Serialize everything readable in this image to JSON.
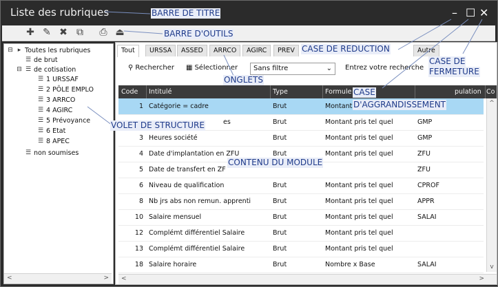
{
  "window": {
    "title": "Liste des rubriques",
    "controls": {
      "minimize": "–",
      "maximize": "☐",
      "close": "✕"
    }
  },
  "toolbar": {
    "icons": [
      {
        "name": "add-icon",
        "glyph": "✚"
      },
      {
        "name": "edit-icon",
        "glyph": "✎"
      },
      {
        "name": "delete-icon",
        "glyph": "✖"
      },
      {
        "name": "duplicate-icon",
        "glyph": "⧉"
      },
      {
        "name": "print-icon",
        "glyph": "⎙"
      },
      {
        "name": "export-icon",
        "glyph": "⏏"
      }
    ]
  },
  "tree": {
    "items": [
      {
        "label": "Toutes les rubriques",
        "expander": "⊟",
        "glyph": "▸",
        "level": 0
      },
      {
        "label": "de brut",
        "expander": "",
        "glyph": "☰",
        "level": 1
      },
      {
        "label": "de cotisation",
        "expander": "⊟",
        "glyph": "☰",
        "level": 1
      },
      {
        "label": "1 URSSAF",
        "expander": "",
        "glyph": "☰",
        "level": 2
      },
      {
        "label": "2 PÔLE EMPLO",
        "expander": "",
        "glyph": "☰",
        "level": 2
      },
      {
        "label": "3 ARRCO",
        "expander": "",
        "glyph": "☰",
        "level": 2
      },
      {
        "label": "4 AGIRC",
        "expander": "",
        "glyph": "☰",
        "level": 2
      },
      {
        "label": "5 Prévoyance",
        "expander": "",
        "glyph": "☰",
        "level": 2
      },
      {
        "label": "6 Etat",
        "expander": "",
        "glyph": "☰",
        "level": 2
      },
      {
        "label": "8 APEC",
        "expander": "",
        "glyph": "☰",
        "level": 2
      },
      {
        "label": "non soumises",
        "expander": "",
        "glyph": "☰",
        "level": 1
      }
    ],
    "scroll_left": "<",
    "scroll_right": ">"
  },
  "tabs": [
    "Tout",
    "URSSA",
    "ASSED",
    "ARRCO",
    "AGIRC",
    "PREV",
    "Autre"
  ],
  "search": {
    "search_label": "Rechercher",
    "select_label": "Sélectionner",
    "filter_value": "Sans filtre",
    "prompt": "Entrez votre recherche"
  },
  "table": {
    "columns": [
      "Code",
      "Intitulé",
      "Type",
      "Formule",
      "pulation",
      "Co"
    ],
    "rows": [
      {
        "code": "1",
        "label": "Catégorie = cadre",
        "type": "Brut",
        "formula": "Montant",
        "pop": ""
      },
      {
        "code": "",
        "label": "es",
        "type": "Brut",
        "formula": "Montant pris tel quel",
        "pop": "GMP"
      },
      {
        "code": "3",
        "label": "Heures société",
        "type": "Brut",
        "formula": "Montant pris tel quel",
        "pop": "GMP"
      },
      {
        "code": "4",
        "label": "Date d'implantation en ZFU",
        "type": "Brut",
        "formula": "Montant pris tel quel",
        "pop": "ZFU"
      },
      {
        "code": "5",
        "label": "Date de transfert en ZF",
        "type": "",
        "formula": "",
        "pop": "ZFU"
      },
      {
        "code": "6",
        "label": "Niveau de qualification",
        "type": "Brut",
        "formula": "Montant pris tel quel",
        "pop": "CPROF"
      },
      {
        "code": "8",
        "label": "Nb jrs abs non remun. apprenti",
        "type": "Brut",
        "formula": "Montant pris tel quel",
        "pop": "APPR"
      },
      {
        "code": "10",
        "label": "Salaire mensuel",
        "type": "Brut",
        "formula": "Montant pris tel quel",
        "pop": "SALAI"
      },
      {
        "code": "12",
        "label": "Complémt différentiel Salaire",
        "type": "Brut",
        "formula": "Montant pris tel quel",
        "pop": ""
      },
      {
        "code": "13",
        "label": "Complémt différentiel Salaire",
        "type": "Brut",
        "formula": "Montant pris tel quel",
        "pop": ""
      },
      {
        "code": "18",
        "label": "Salaire horaire",
        "type": "Brut",
        "formula": "Nombre x Base",
        "pop": "SALAI"
      }
    ],
    "scroll_up": "^",
    "scroll_down": "v",
    "scroll_left": "<",
    "scroll_right": ">"
  },
  "callouts": {
    "barre_titre": "BARRE DE TITRE",
    "barre_outils": "BARRE D'OUTILS",
    "case_reduction": "CASE DE REDUCTION",
    "case_fermeture_1": "CASE DE",
    "case_fermeture_2": "FERMETURE",
    "case_agrandissement_1": "CASE",
    "case_agrandissement_2": "D'AGGRANDISSEMENT",
    "onglets": "ONGLETS",
    "volet_structure": "VOLET DE STRUCTURE",
    "contenu_module": "CONTENU DU MODULE"
  },
  "colors": {
    "titlebar": "#2b2b2b",
    "header": "#3b3b3b",
    "selection": "#a8d8f4",
    "callout_text": "#1e3a8a",
    "callout_bg": "#e9edf8"
  }
}
